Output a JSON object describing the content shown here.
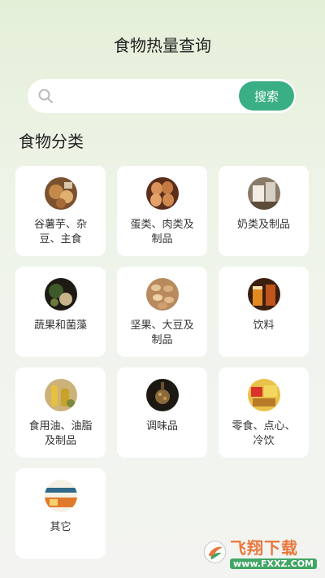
{
  "header": {
    "title": "食物热量查询"
  },
  "search": {
    "placeholder": "",
    "value": "",
    "button_label": "搜索",
    "accent": "#3aae84"
  },
  "section": {
    "title": "食物分类"
  },
  "categories": [
    {
      "label": "谷薯芋、杂豆、主食",
      "icon": "grain-food-icon"
    },
    {
      "label": "蛋类、肉类及制品",
      "icon": "egg-meat-icon"
    },
    {
      "label": "奶类及制品",
      "icon": "milk-icon"
    },
    {
      "label": "蔬果和菌藻",
      "icon": "vegetable-icon"
    },
    {
      "label": "坚果、大豆及制品",
      "icon": "nut-icon"
    },
    {
      "label": "饮料",
      "icon": "drink-icon"
    },
    {
      "label": "食用油、油脂及制品",
      "icon": "oil-icon"
    },
    {
      "label": "调味品",
      "icon": "seasoning-icon"
    },
    {
      "label": "零食、点心、冷饮",
      "icon": "snack-icon"
    },
    {
      "label": "其它",
      "icon": "other-food-icon"
    }
  ],
  "watermark": {
    "brand": "飞翔下载",
    "url": "www.FXXZ.COM"
  }
}
